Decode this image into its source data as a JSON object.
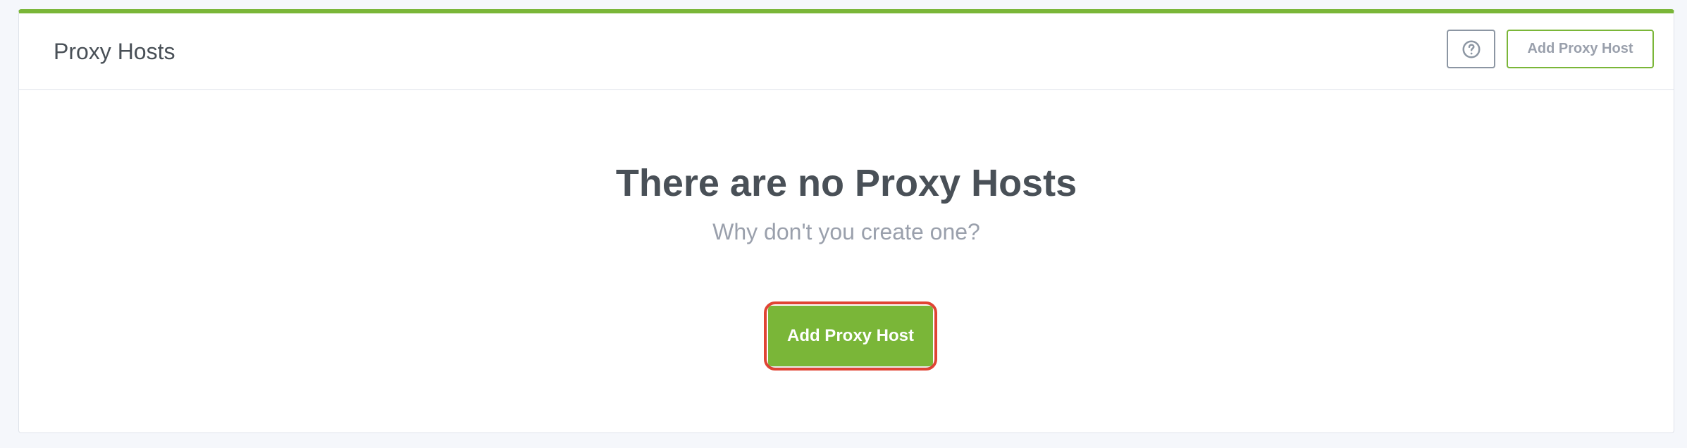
{
  "card": {
    "title": "Proxy Hosts",
    "accent_color": "#7ab638",
    "header_actions": {
      "help_icon": "question-circle-icon",
      "add_button_label": "Add Proxy Host"
    }
  },
  "empty_state": {
    "title": "There are no Proxy Hosts",
    "subtitle": "Why don't you create one?",
    "add_button_label": "Add Proxy Host",
    "highlight_color": "#e04434"
  }
}
